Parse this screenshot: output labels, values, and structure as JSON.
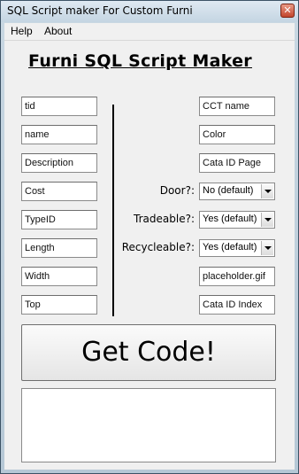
{
  "window": {
    "title": "SQL Script maker For Custom Furni",
    "close_glyph": "✕"
  },
  "menu": {
    "items": [
      "Help",
      "About"
    ]
  },
  "heading": "Furni SQL Script Maker",
  "left_fields": [
    {
      "value": "tid"
    },
    {
      "value": "name"
    },
    {
      "value": "Description"
    },
    {
      "value": "Cost"
    },
    {
      "value": "TypeID"
    },
    {
      "value": "Length"
    },
    {
      "value": "Width"
    },
    {
      "value": "Top"
    }
  ],
  "right_fields": {
    "cct_name": "CCT name",
    "color": "Color",
    "cata_id_page": "Cata ID Page",
    "image": "placeholder.gif",
    "cata_id_index": "Cata ID Index"
  },
  "options": {
    "door": {
      "label": "Door?:",
      "selected": "No (default)"
    },
    "tradeable": {
      "label": "Tradeable?:",
      "selected": "Yes (default)"
    },
    "recycleable": {
      "label": "Recycleable?:",
      "selected": "Yes (default)"
    }
  },
  "get_code_label": "Get Code!",
  "output_text": ""
}
